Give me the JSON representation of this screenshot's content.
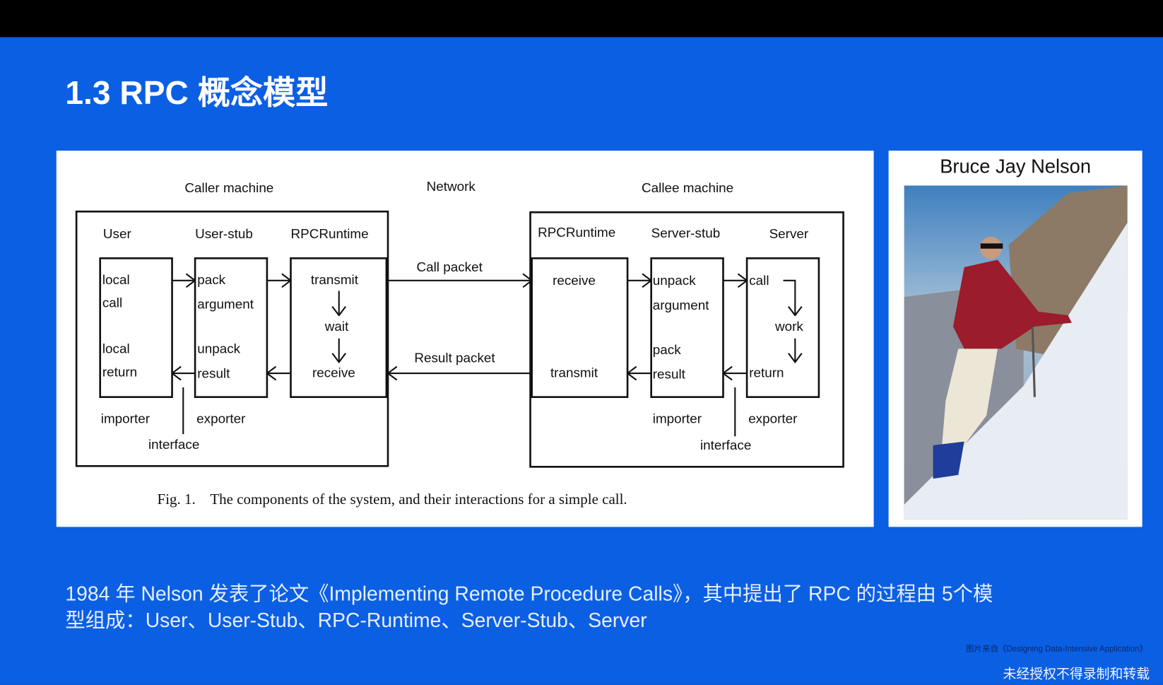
{
  "slide": {
    "title": "1.3 RPC 概念模型",
    "description_line1": "1984 年 Nelson 发表了论文《Implementing Remote Procedure Calls》，其中提出了 RPC 的过程由 5个模",
    "description_line2": "型组成：User、User-Stub、RPC-Runtime、Server-Stub、Server",
    "image_credit": "图片来自《Designing Data-Intensive Application》",
    "watermark": "未经授权不得录制和转载",
    "colors": {
      "background": "#0b5fe3",
      "topbar": "#000000"
    }
  },
  "diagram": {
    "caller_machine": "Caller machine",
    "network": "Network",
    "callee_machine": "Callee machine",
    "caller": {
      "user": "User",
      "user_stub": "User-stub",
      "runtime": "RPCRuntime",
      "local": "local",
      "call": "call",
      "local2": "local",
      "return": "return",
      "pack": "pack",
      "argument": "argument",
      "unpack": "unpack",
      "result": "result",
      "transmit": "transmit",
      "wait": "wait",
      "receive": "receive",
      "importer": "importer",
      "exporter": "exporter",
      "interface": "interface"
    },
    "call_packet": "Call packet",
    "result_packet": "Result packet",
    "callee": {
      "runtime": "RPCRuntime",
      "server_stub": "Server-stub",
      "server": "Server",
      "receive": "receive",
      "transmit": "transmit",
      "unpack": "unpack",
      "argument": "argument",
      "pack": "pack",
      "result": "result",
      "call": "call",
      "work": "work",
      "return": "return",
      "importer": "importer",
      "exporter": "exporter",
      "interface": "interface"
    },
    "caption": "Fig. 1.    The components of the system, and their interactions for a simple call."
  },
  "photo": {
    "name": "Bruce Jay Nelson"
  }
}
